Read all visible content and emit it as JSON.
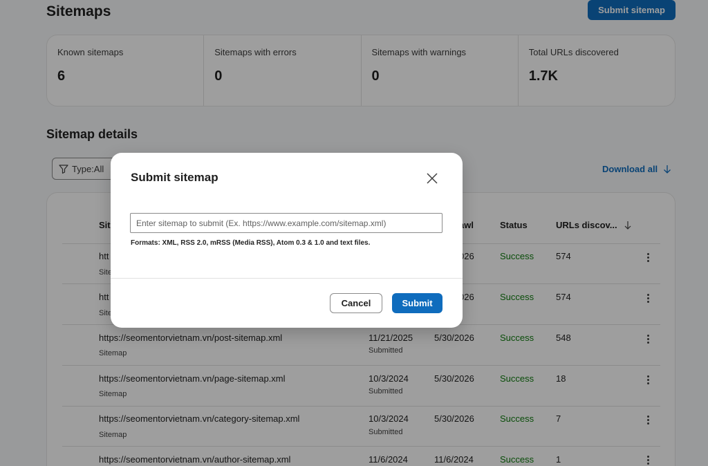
{
  "header": {
    "title": "Sitemaps",
    "submit_label": "Submit sitemap"
  },
  "stats": [
    {
      "label": "Known sitemaps",
      "value": "6"
    },
    {
      "label": "Sitemaps with errors",
      "value": "0"
    },
    {
      "label": "Sitemaps with warnings",
      "value": "0"
    },
    {
      "label": "Total URLs discovered",
      "value": "1.7K"
    }
  ],
  "details": {
    "title": "Sitemap details",
    "filter_label": "Type:All",
    "download_label": "Download all"
  },
  "table": {
    "columns": {
      "sitemap": "Site",
      "last_crawl": "awl",
      "status": "Status",
      "urls": "URLs discov..."
    },
    "rows": [
      {
        "url": "htt",
        "type": "Site",
        "submitted": "",
        "submitted_label": "",
        "last_crawl": "026",
        "status": "Success",
        "urls": "574"
      },
      {
        "url": "htt",
        "type": "Site",
        "submitted": "",
        "submitted_label": "",
        "last_crawl": "026",
        "status": "Success",
        "urls": "574"
      },
      {
        "url": "https://seomentorvietnam.vn/post-sitemap.xml",
        "type": "Sitemap",
        "submitted": "11/21/2025",
        "submitted_label": "Submitted",
        "last_crawl": "5/30/2026",
        "status": "Success",
        "urls": "548"
      },
      {
        "url": "https://seomentorvietnam.vn/page-sitemap.xml",
        "type": "Sitemap",
        "submitted": "10/3/2024",
        "submitted_label": "Submitted",
        "last_crawl": "5/30/2026",
        "status": "Success",
        "urls": "18"
      },
      {
        "url": "https://seomentorvietnam.vn/category-sitemap.xml",
        "type": "Sitemap",
        "submitted": "10/3/2024",
        "submitted_label": "Submitted",
        "last_crawl": "5/30/2026",
        "status": "Success",
        "urls": "7"
      },
      {
        "url": "https://seomentorvietnam.vn/author-sitemap.xml",
        "type": "",
        "submitted": "11/6/2024",
        "submitted_label": "",
        "last_crawl": "11/6/2024",
        "status": "Success",
        "urls": "1"
      }
    ]
  },
  "dialog": {
    "title": "Submit sitemap",
    "input_value": "",
    "input_placeholder": "Enter sitemap to submit (Ex. https://www.example.com/sitemap.xml)",
    "hint": "Formats: XML, RSS 2.0, mRSS (Media RSS), Atom 0.3 & 1.0 and text files.",
    "cancel_label": "Cancel",
    "submit_label": "Submit"
  },
  "colors": {
    "accent": "#0f6cbd",
    "success": "#107c10"
  }
}
